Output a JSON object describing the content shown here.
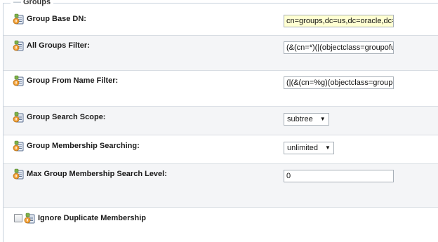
{
  "section": {
    "title": "Groups"
  },
  "fields": {
    "group_base_dn": {
      "label": "Group Base DN:",
      "value": "cn=groups,dc=us,dc=oracle,dc=com"
    },
    "all_groups_filter": {
      "label": "All Groups Filter:",
      "value": "(&(cn=*)(|(objectclass=groupofuniquenames)(objectclass=orcldynamicgroup)))"
    },
    "group_from_name_filter": {
      "label": "Group From Name Filter:",
      "value": "(|(&(cn=%g)(objectclass=groupofuniquenames))(&(cn=%g)(objectclass=orcldynamicgroup)))"
    },
    "group_search_scope": {
      "label": "Group Search Scope:",
      "selected": "subtree"
    },
    "group_membership_searching": {
      "label": "Group Membership Searching:",
      "selected": "unlimited"
    },
    "max_group_membership_search_level": {
      "label": "Max Group Membership Search Level:",
      "value": "0"
    },
    "ignore_duplicate_membership": {
      "label": "Ignore Duplicate Membership",
      "checked": false
    }
  },
  "icons": {
    "field_help": "field-help-icon"
  },
  "colors": {
    "highlight_field": "#ffffd2",
    "row_shade": "#f4f5f7",
    "border": "#c8d2dc"
  }
}
